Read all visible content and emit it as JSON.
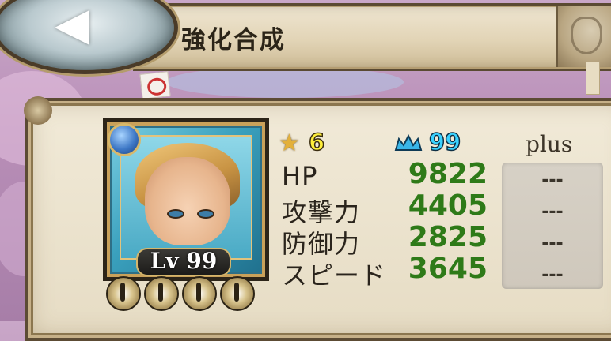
{
  "header": {
    "title": "強化合成",
    "back_icon": "back-arrow-icon"
  },
  "character": {
    "level_label": "Lv 99",
    "element_icon": "water-element-icon",
    "skill_icons": [
      "sword-emblem-icon",
      "sword-emblem-icon",
      "sword-emblem-icon",
      "sword-emblem-icon"
    ]
  },
  "stats": {
    "stars": "6",
    "limit": "99",
    "plus_header": "plus",
    "rows": [
      {
        "label": "HP",
        "value": "9822",
        "plus": "---"
      },
      {
        "label": "攻撃力",
        "value": "4405",
        "plus": "---"
      },
      {
        "label": "防御力",
        "value": "2825",
        "plus": "---"
      },
      {
        "label": "スピード",
        "value": "3645",
        "plus": "---"
      }
    ]
  },
  "colors": {
    "stat_value": "#2e7a18",
    "star": "#ffef3a",
    "crown": "#3ad2ff",
    "panel": "#efe6d2"
  }
}
